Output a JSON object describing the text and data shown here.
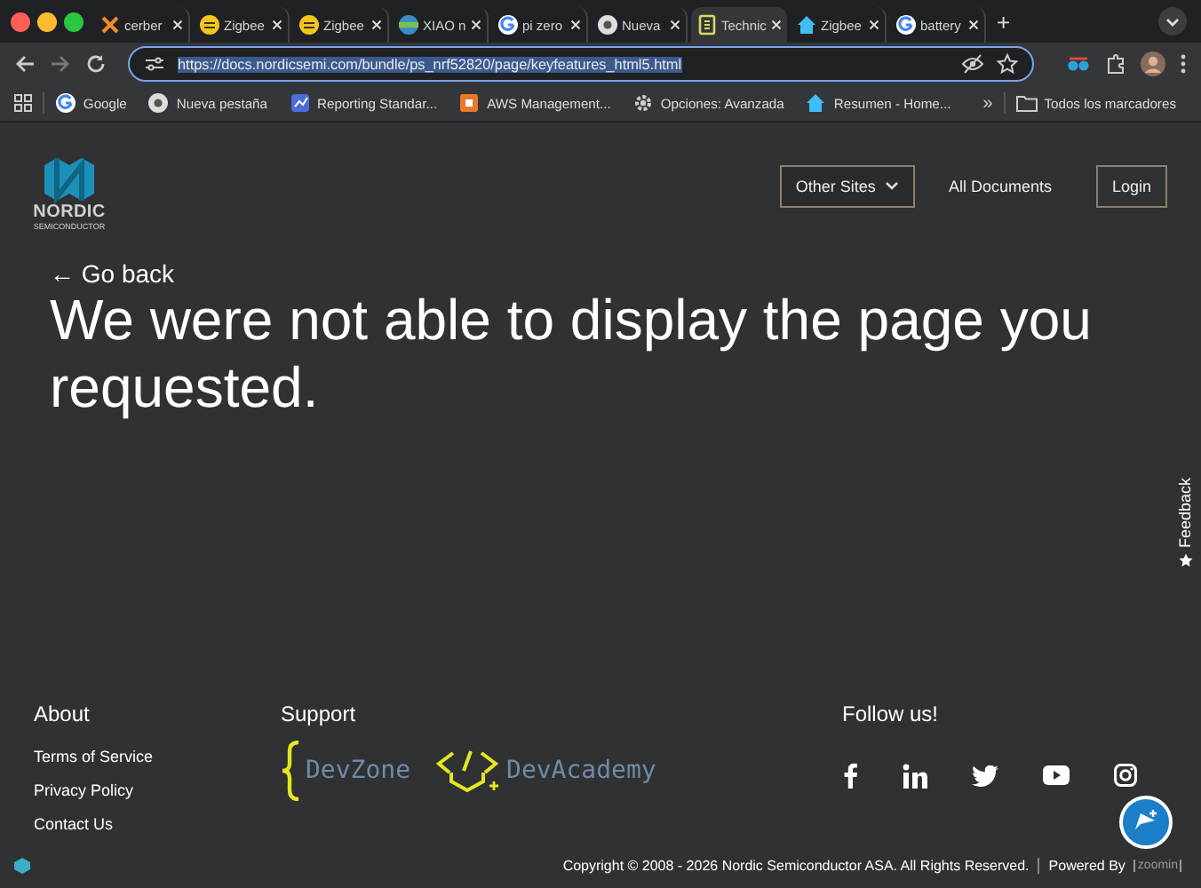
{
  "tabs": [
    {
      "label": "cerber",
      "selected": false
    },
    {
      "label": "Zigbee",
      "selected": false
    },
    {
      "label": "Zigbee",
      "selected": false
    },
    {
      "label": "XIAO n",
      "selected": false
    },
    {
      "label": "pi zero",
      "selected": false
    },
    {
      "label": "Nueva",
      "selected": false
    },
    {
      "label": "Technic",
      "selected": true
    },
    {
      "label": "Zigbee",
      "selected": false
    },
    {
      "label": "battery",
      "selected": false
    }
  ],
  "new_tab": "+",
  "address_bar": {
    "url": "https://docs.nordicsemi.com/bundle/ps_nrf52820/page/keyfeatures_html5.html"
  },
  "bookmarks": [
    {
      "label": "Google"
    },
    {
      "label": "Nueva pestaña"
    },
    {
      "label": "Reporting Standar..."
    },
    {
      "label": "AWS Management..."
    },
    {
      "label": "Opciones: Avanzada"
    },
    {
      "label": "Resumen - Home..."
    }
  ],
  "bookmarks_more": "»",
  "all_bookmarks": "Todos los marcadores",
  "header": {
    "logo_text": "NORDIC",
    "logo_sub": "SEMICONDUCTOR",
    "nav": [
      "Other Sites",
      "All Documents",
      "Login"
    ]
  },
  "go_back": "← Go back",
  "message": "We were not able to display the page you requested.",
  "feedback": "Feedback",
  "footer": {
    "about_title": "About",
    "about_links": [
      "Terms of Service",
      "Privacy Policy",
      "Contact Us"
    ],
    "support_title": "Support",
    "devzone": "DevZone",
    "devacademy": "DevAcademy",
    "follow_title": "Follow us!",
    "copyright": "Copyright © 2008 - 2026 Nordic Semiconductor ASA. All Rights Reserved.",
    "powered_by": "Powered By",
    "powered_logo": "zoomin"
  }
}
